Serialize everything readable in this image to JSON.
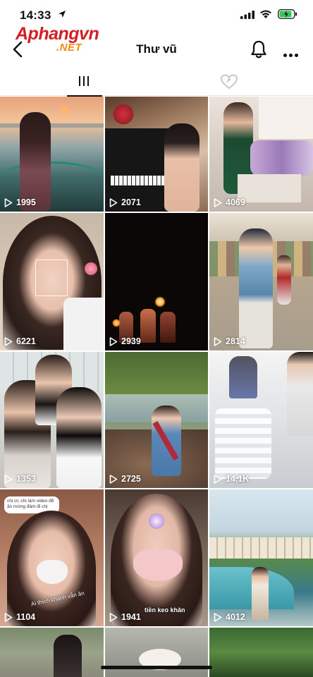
{
  "status_bar": {
    "time": "14:33"
  },
  "header": {
    "logo_main": "Aphangvn",
    "logo_sub": ".NET",
    "title": "Thư vũ"
  },
  "tabs": [
    {
      "icon": "video-grid-icon",
      "selected": true
    },
    {
      "icon": "liked-heart-icon",
      "selected": false
    }
  ],
  "videos": [
    {
      "views": "1995"
    },
    {
      "views": "2071"
    },
    {
      "views": "4069"
    },
    {
      "views": "6221"
    },
    {
      "views": "2939"
    },
    {
      "views": "2814"
    },
    {
      "views": "1353"
    },
    {
      "views": "2725"
    },
    {
      "views": "14,1K"
    },
    {
      "views": "1104"
    },
    {
      "views": "1941"
    },
    {
      "views": "4012"
    },
    {
      "views": ""
    },
    {
      "views": ""
    },
    {
      "views": ""
    }
  ],
  "overlays": {
    "comment_reply": "chị ơi, chị làm video để ăn mừng đám đi chị",
    "video_caption": "Ai thích khánh vẫn ăn",
    "tile11_caption": "tiền keo khăn"
  },
  "colors": {
    "accent": "#d21f26",
    "logo_sub": "#f08a12",
    "text": "#111111"
  }
}
